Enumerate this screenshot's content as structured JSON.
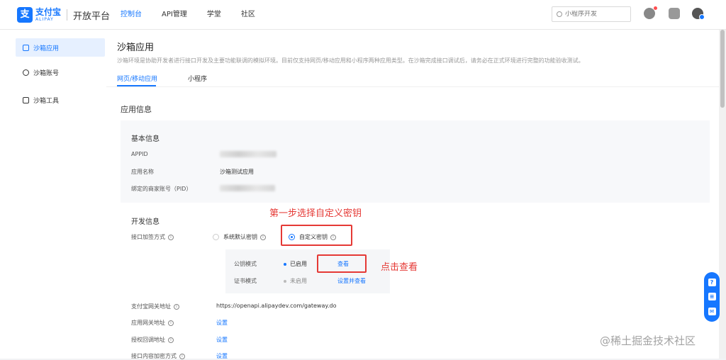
{
  "header": {
    "logo_cn": "支付宝",
    "logo_en": "ALIPAY",
    "platform": "开放平台",
    "nav": [
      "控制台",
      "API管理",
      "学堂",
      "社区"
    ],
    "search_placeholder": "小程序开发"
  },
  "sidebar": {
    "items": [
      {
        "label": "沙箱应用",
        "icon": "cube-icon"
      },
      {
        "label": "沙箱账号",
        "icon": "user-icon"
      },
      {
        "label": "沙箱工具",
        "icon": "toolbox-icon"
      }
    ]
  },
  "main": {
    "title": "沙箱应用",
    "description": "沙箱环境是协助开发者进行接口开发及主要功能联调的模拟环境。目前仅支持网页/移动应用和小程序两种应用类型。在沙箱完成接口调试后，请务必在正式环境进行完整的功能验收测试。",
    "tabs": [
      "网页/移动应用",
      "小程序"
    ],
    "section_title": "应用信息",
    "basic": {
      "title": "基本信息",
      "appid_label": "APPID",
      "name_label": "应用名称",
      "name_value": "沙箱测试应用",
      "pid_label": "绑定的商家账号（PID）"
    },
    "dev": {
      "title": "开发信息",
      "sign_label": "接口加签方式",
      "option_default": "系统默认密钥",
      "option_custom": "自定义密钥",
      "pubkey_label": "公钥模式",
      "pubkey_status": "已启用",
      "pubkey_link": "查看",
      "cert_label": "证书模式",
      "cert_status": "未启用",
      "cert_link": "设置并查看",
      "gateway_label": "支付宝网关地址",
      "gateway_value": "https://openapi.alipaydev.com/gateway.do",
      "app_gateway_label": "应用网关地址",
      "app_gateway_link": "设置",
      "callback_label": "授权回调地址",
      "callback_link": "设置",
      "encrypt_label": "接口内容加密方式",
      "encrypt_link": "设置"
    }
  },
  "annotations": {
    "step1": "第一步选择自定义密钥",
    "step2": "点击查看"
  },
  "watermark": "@稀土掘金技术社区",
  "colors": {
    "accent": "#1677ff",
    "annotation": "#e53935"
  }
}
